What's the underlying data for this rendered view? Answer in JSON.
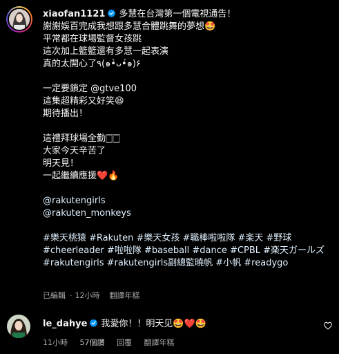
{
  "post": {
    "username": "xiaofan1121",
    "lines": [
      "多慧在台灣第一個電視通告！",
      "謝謝娛百完成我想跟多慧合體跳舞的夢想🤩",
      "平常都在球場監督女孩跳",
      "這次加上籃籃還有多慧一起表演",
      "真的太開心了٩(๑•̀ᴗ•́๑)۶",
      "",
      "一定要鎖定 @gtve100",
      "這集超精彩又好笑😆",
      "期待播出！",
      "",
      "這禮拜球場全勤🀆🀆",
      "大家今天辛苦了",
      "明天見！",
      "一起繼續應援❤️🔥",
      "",
      "@rakutengirls",
      "@rakuten_monkeys",
      "",
      "#樂天桃猿 #Rakuten #樂天女孩 #職棒啦啦隊 #楽天 #野球",
      "#cheerleader #啦啦隊 #baseball #dance #CPBL #楽天ガールズ",
      "#rakutengirls #rakutengirls副總監曉帆 #小帆 #readygo"
    ],
    "meta": {
      "edited": "已編輯",
      "dot": "·",
      "time": "12小時",
      "translate": "翻譯年糕"
    }
  },
  "reply": {
    "username": "le_dahye",
    "text": "我愛你！！明天见🤩❤️🤩",
    "meta": {
      "time": "11小時",
      "likes": "57個讚",
      "reply": "回覆",
      "translate": "翻譯年糕"
    }
  },
  "colors": {
    "background": "#000000",
    "text": "#f5f5f5",
    "secondary": "#a8a8a8",
    "verified": "#0095f6"
  },
  "icons": {
    "verified": "verified-badge-icon",
    "like": "heart-outline-icon"
  }
}
